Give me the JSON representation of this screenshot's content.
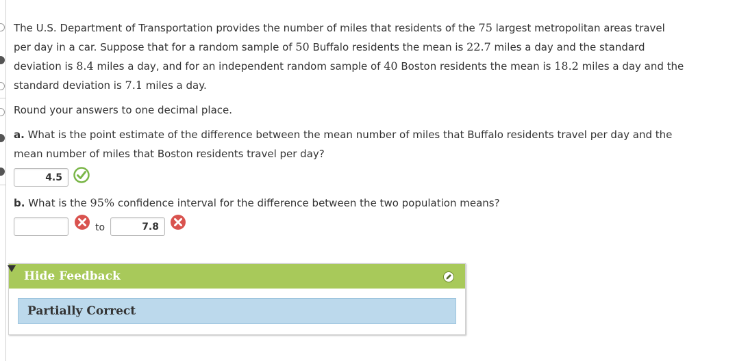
{
  "question": {
    "para1_a": "The U.S. Department of Transportation provides the number of miles that residents of the ",
    "n_areas": "75",
    "para1_b": " largest metropolitan areas travel",
    "para2_a": "per day in a car. Suppose that for a random sample of ",
    "n_buffalo": "50",
    "para2_b": " Buffalo residents the mean is ",
    "mean_buffalo": "22.7",
    "para2_c": " miles a day and the standard",
    "para3_a": "deviation is ",
    "sd_buffalo": "8.4",
    "para3_b": " miles a day, and for an independent random sample of ",
    "n_boston": "40",
    "para3_c": " Boston residents the mean is ",
    "mean_boston": "18.2",
    "para3_d": " miles a day and the",
    "para4_a": "standard deviation is ",
    "sd_boston": "7.1",
    "para4_b": " miles a day.",
    "round_note": "Round your answers to one decimal place."
  },
  "part_a": {
    "label": "a.",
    "text_line1": " What is the point estimate of the difference between the mean number of miles that Buffalo residents travel per day and the",
    "text_line2": "mean number of miles that Boston residents travel per day?",
    "answer": "4.5",
    "status_icon": "check-icon"
  },
  "part_b": {
    "label": "b.",
    "text_a": " What is the ",
    "pct": "95%",
    "text_b": " confidence interval for the difference between the two population means?",
    "lower_value": "",
    "to_label": "to",
    "upper_value": "7.8",
    "lower_status_icon": "x-icon",
    "upper_status_icon": "x-icon"
  },
  "feedback": {
    "toggle_label": "Hide Feedback",
    "status": "Partially Correct"
  },
  "colors": {
    "feedback_header": "#a8c95a",
    "status_box": "#bcd9ec",
    "correct": "#7ab648",
    "incorrect": "#d9534f"
  }
}
